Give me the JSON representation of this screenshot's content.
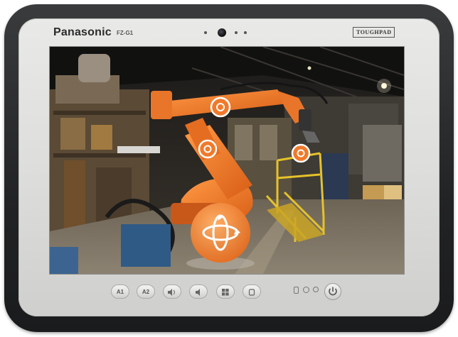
{
  "device": {
    "brand": "Panasonic",
    "model": "FZ-G1",
    "series_badge": "TOUGHPAD"
  },
  "hardware_buttons": [
    {
      "label": "A1"
    },
    {
      "label": "A2"
    },
    {
      "icon": "volume-up-icon"
    },
    {
      "icon": "volume-down-icon"
    },
    {
      "icon": "windows-icon"
    },
    {
      "icon": "rotation-lock-icon"
    }
  ],
  "screen": {
    "scene": "factory-floor",
    "overlay_accent": "#f07a2b",
    "hotspots": [
      "arm-hotspot",
      "elbow-hotspot",
      "wrist-hotspot"
    ],
    "control": "rotate-360-icon"
  },
  "colors": {
    "bezel": "#dcdcda",
    "bumper": "#222325",
    "robot": "#f07a2b"
  }
}
